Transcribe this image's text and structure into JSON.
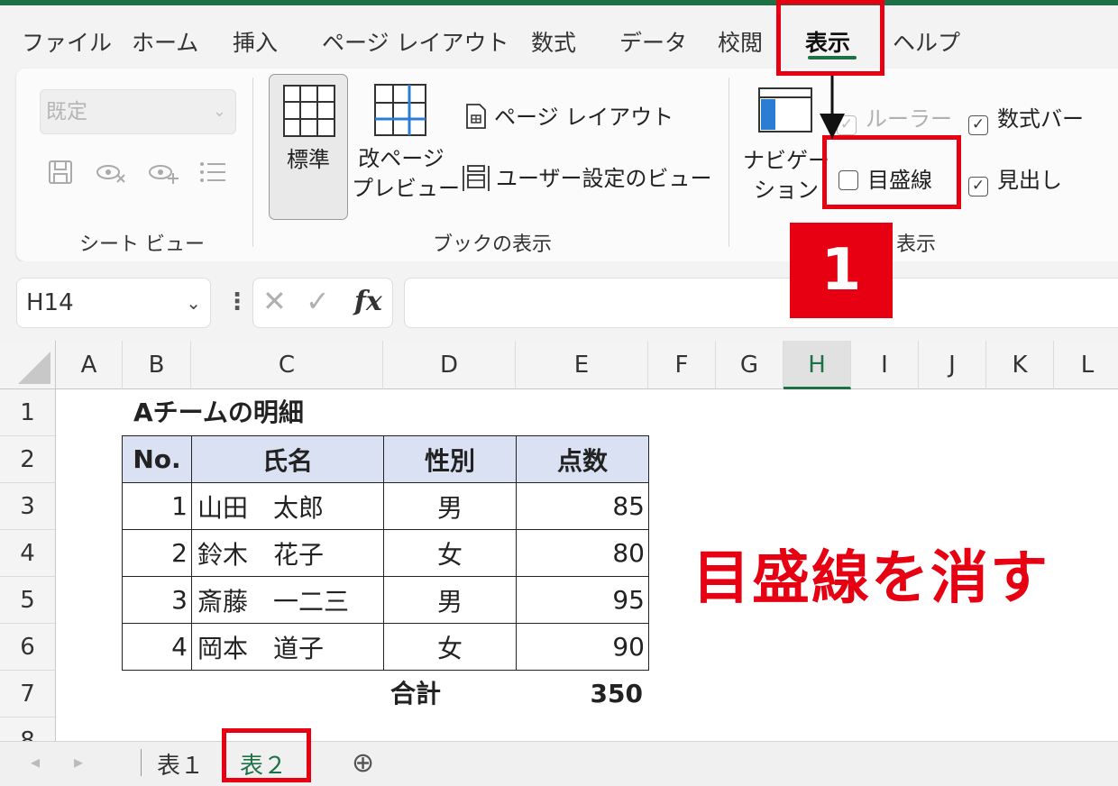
{
  "menu": {
    "tabs": [
      {
        "label": "ファイル"
      },
      {
        "label": "ホーム"
      },
      {
        "label": "挿入"
      },
      {
        "label": "ページ レイアウト"
      },
      {
        "label": "数式"
      },
      {
        "label": "データ"
      },
      {
        "label": "校閲"
      },
      {
        "label": "表示"
      },
      {
        "label": "ヘルプ"
      }
    ],
    "active": "表示"
  },
  "ribbon": {
    "sheet_view": {
      "select_value": "既定",
      "group_label": "シート ビュー"
    },
    "workbook_views": {
      "normal": "標準",
      "page_break_line1": "改ページ",
      "page_break_line2": "プレビュー",
      "page_layout": "ページ レイアウト",
      "custom_views": "ユーザー設定のビュー",
      "group_label": "ブックの表示"
    },
    "show": {
      "navigation_line1": "ナビゲー",
      "navigation_line2": "ション",
      "ruler": {
        "label": "ルーラー",
        "checked": true,
        "disabled": true
      },
      "formula_bar": {
        "label": "数式バー",
        "checked": true
      },
      "gridlines": {
        "label": "目盛線",
        "checked": false
      },
      "headings": {
        "label": "見出し",
        "checked": true
      },
      "group_label": "表示"
    }
  },
  "formula_bar": {
    "name_box": "H14",
    "cancel": "✕",
    "enter": "✓",
    "fx": "fx",
    "value": ""
  },
  "grid": {
    "columns": [
      "A",
      "B",
      "C",
      "D",
      "E",
      "F",
      "G",
      "H",
      "I",
      "J",
      "K",
      "L"
    ],
    "selected_column": "H",
    "rows": [
      "1",
      "2",
      "3",
      "4",
      "5",
      "6",
      "7",
      "8"
    ],
    "title": "Aチームの明細",
    "table": {
      "headers": [
        "No.",
        "氏名",
        "性別",
        "点数"
      ],
      "rows": [
        [
          "1",
          "山田　太郎",
          "男",
          "85"
        ],
        [
          "2",
          "鈴木　花子",
          "女",
          "80"
        ],
        [
          "3",
          "斎藤　一二三",
          "男",
          "95"
        ],
        [
          "4",
          "岡本　道子",
          "女",
          "90"
        ]
      ],
      "total_label": "合計",
      "total_value": "350"
    }
  },
  "sheets": {
    "tabs": [
      "表１",
      "表２"
    ],
    "active": "表２",
    "add": "⊕"
  },
  "annotation": {
    "step": "1",
    "text": "目盛線を消す",
    "color": "#e60012"
  },
  "colors": {
    "accent": "#1e7145",
    "header_fill": "#d9e1f2"
  }
}
